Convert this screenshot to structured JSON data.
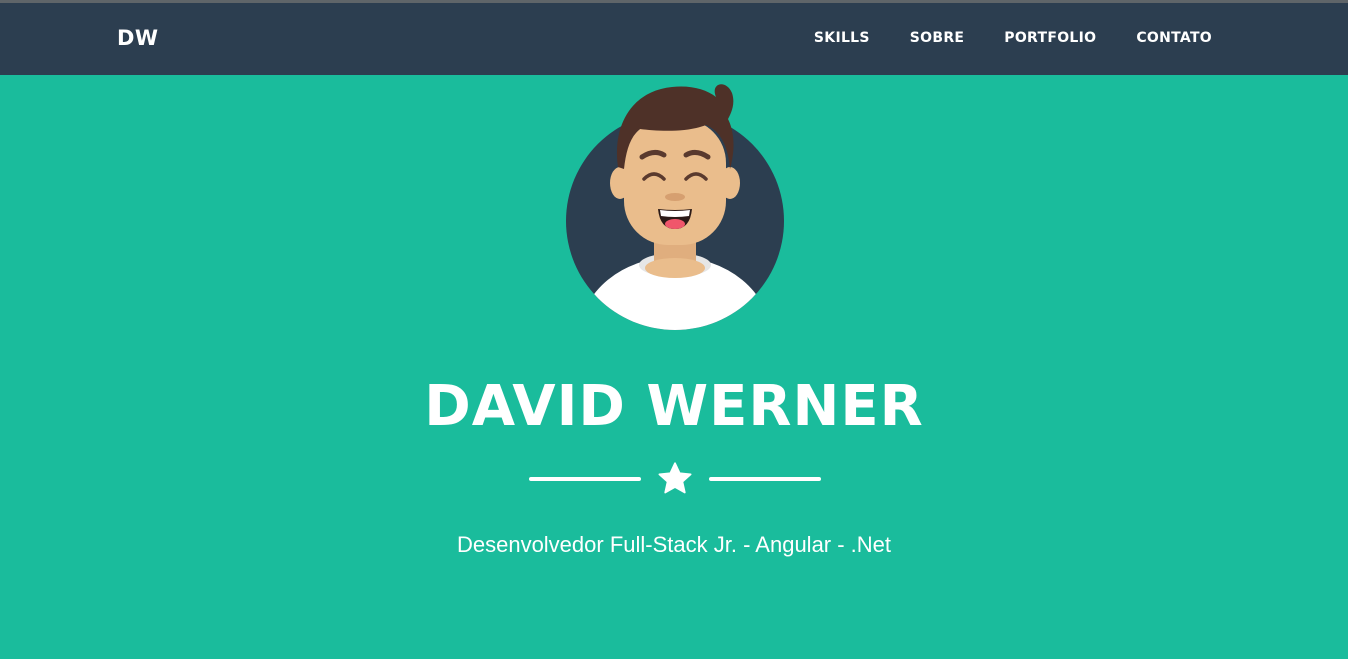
{
  "navbar": {
    "brand": "DW",
    "links": [
      {
        "label": "SKILLS"
      },
      {
        "label": "SOBRE"
      },
      {
        "label": "PORTFOLIO"
      },
      {
        "label": "CONTATO"
      }
    ]
  },
  "hero": {
    "avatar_icon": "person-avatar-icon",
    "name": "DAVID WERNER",
    "divider_icon": "star-icon",
    "tagline": "Desenvolvedor Full-Stack Jr. - Angular - .Net"
  },
  "colors": {
    "accent": "#1abc9c",
    "navbar": "#2c3e50",
    "text": "#ffffff"
  }
}
